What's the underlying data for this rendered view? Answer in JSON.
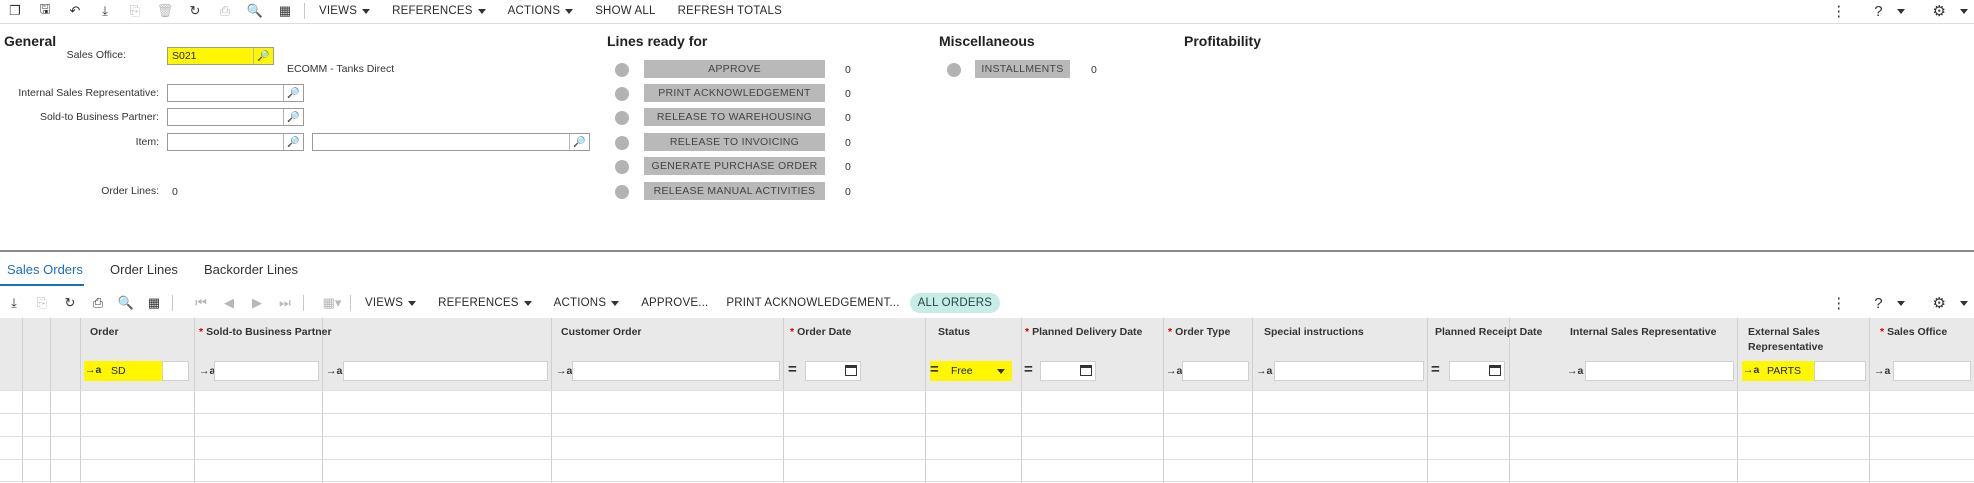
{
  "toolbar": {
    "icons": [
      "new-icon",
      "save-icon",
      "undo-icon",
      "export-icon",
      "copy-icon",
      "delete-icon",
      "refresh-icon",
      "print-icon",
      "search-icon",
      "calendar-icon"
    ],
    "views": "VIEWS",
    "references": "REFERENCES",
    "actions": "ACTIONS",
    "show_all": "SHOW ALL",
    "refresh_totals": "REFRESH TOTALS",
    "help": "?"
  },
  "general": {
    "title": "General",
    "sales_office_label": "Sales Office:",
    "sales_office_value": "S021",
    "sales_office_desc": "ECOMM - Tanks Direct",
    "internal_rep_label": "Internal Sales Representative:",
    "sold_to_label": "Sold-to Business Partner:",
    "item_label": "Item:",
    "order_lines_label": "Order Lines:",
    "order_lines_value": "0"
  },
  "lines_ready": {
    "title": "Lines ready for",
    "items": [
      {
        "label": "APPROVE",
        "count": "0"
      },
      {
        "label": "PRINT ACKNOWLEDGEMENT",
        "count": "0"
      },
      {
        "label": "RELEASE TO WAREHOUSING",
        "count": "0"
      },
      {
        "label": "RELEASE TO INVOICING",
        "count": "0"
      },
      {
        "label": "GENERATE PURCHASE ORDER",
        "count": "0"
      },
      {
        "label": "RELEASE MANUAL ACTIVITIES",
        "count": "0"
      }
    ]
  },
  "misc": {
    "title": "Miscellaneous",
    "installments_label": "INSTALLMENTS",
    "installments_count": "0"
  },
  "profitability": {
    "title": "Profitability"
  },
  "tabs": [
    "Sales Orders",
    "Order Lines",
    "Backorder Lines"
  ],
  "grid_toolbar": {
    "views": "VIEWS",
    "references": "REFERENCES",
    "actions": "ACTIONS",
    "approve": "APPROVE...",
    "print_ack": "PRINT ACKNOWLEDGEMENT...",
    "all_orders": "ALL ORDERS",
    "help": "?"
  },
  "grid": {
    "columns": [
      {
        "title": "Order",
        "required": false
      },
      {
        "title": "Sold-to Business Partner",
        "required": true
      },
      {
        "title": "Customer Order",
        "required": false
      },
      {
        "title": "Order Date",
        "required": true
      },
      {
        "title": "Status",
        "required": false
      },
      {
        "title": "Planned Delivery Date",
        "required": true
      },
      {
        "title": "Order Type",
        "required": true
      },
      {
        "title": "Special instructions",
        "required": false
      },
      {
        "title": "Planned Receipt Date",
        "required": false
      },
      {
        "title": "Internal Sales Representative",
        "required": false
      },
      {
        "title": "External Sales Representative",
        "required": false
      },
      {
        "title": "Sales Office",
        "required": true
      }
    ],
    "filters": {
      "order": "SD",
      "status": "Free",
      "external_rep": "PARTS",
      "text_prefix": "→a",
      "equals_prefix": "="
    }
  },
  "colors": {
    "highlight": "#fff700",
    "accent": "#1b6ec2",
    "pill_bg": "#c7ede6",
    "button_gray": "#b9b9b9",
    "header_bg": "#e9e9e9",
    "required_star": "#d00000"
  }
}
